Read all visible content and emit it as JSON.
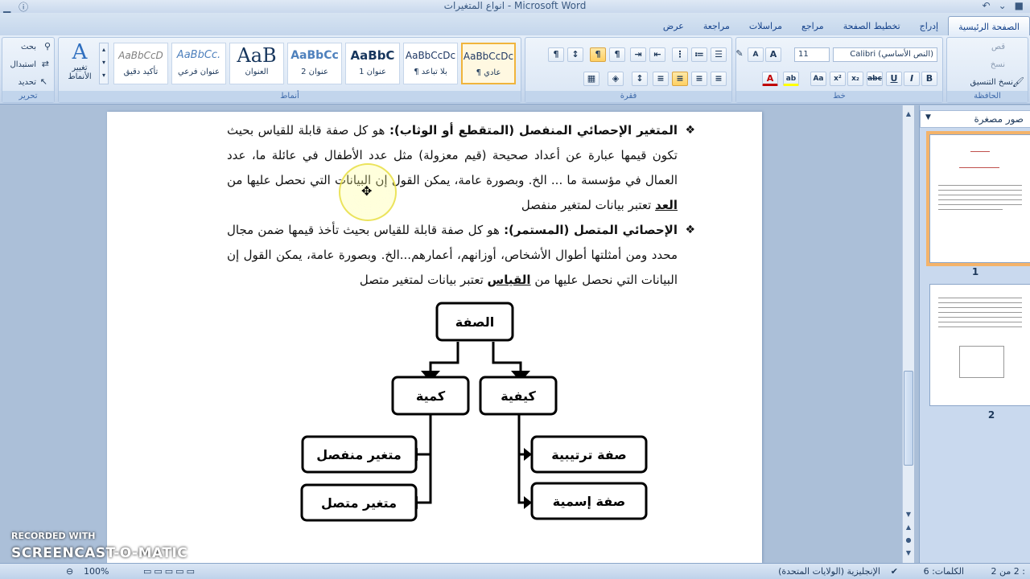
{
  "window": {
    "title": "انواع المتغيرات - Microsoft Word"
  },
  "tabs": [
    "الصفحة الرئيسية",
    "إدراج",
    "تخطيط الصفحة",
    "مراجع",
    "مراسلات",
    "مراجعة",
    "عرض"
  ],
  "ribbon": {
    "clipboard": {
      "label": "الحافظة",
      "cut": "قص",
      "copy": "نسخ",
      "format_painter": "نسخ التنسيق"
    },
    "font": {
      "label": "خط",
      "name": "(النص الأساسي) Calibri",
      "size": "11"
    },
    "paragraph": {
      "label": "فقرة"
    },
    "styles": {
      "label": "أنماط",
      "change_styles": "تغيير الأنماط",
      "items": [
        {
          "preview": "AaBbCcDc",
          "name": "¶ عادي"
        },
        {
          "preview": "AaBbCcDc",
          "name": "¶ بلا تباعد"
        },
        {
          "preview": "AaBbC",
          "name": "عنوان 1"
        },
        {
          "preview": "AaBbCc",
          "name": "عنوان 2"
        },
        {
          "preview": "AaB",
          "name": "العنوان"
        },
        {
          "preview": "AaBbCc.",
          "name": "عنوان فرعي"
        },
        {
          "preview": "AaBbCcD",
          "name": "تأكيد دقيق"
        }
      ]
    },
    "editing": {
      "label": "تحرير",
      "find": "بحث",
      "replace": "استبدال",
      "select": "تحديد"
    }
  },
  "document": {
    "para1": {
      "bold": "المتغير الإحصائي المنفصل (المتقطع أو الوثاب):",
      "text": " هو كل صفة قابلة للقياس بحيث تكون قيمها عبارة عن أعداد صحيحة (قيم معزولة) مثل عدد الأطفال في عائلة ما، عدد العمال في مؤسسة ما ... الخ. وبصورة عامة، يمكن القول إن البيانات التي نحصل عليها من ",
      "underline": "العد",
      "tail": " تعتبر بيانات لمتغير منفصل"
    },
    "para2": {
      "bold": "الإحصائي المتصل (المستمر):",
      "text": " هو كل صفة قابلة للقياس بحيث تأخذ قيمها ضمن مجال محدد ومن أمثلتها أطوال الأشخاص، أوزانهم، أعمارهم...الخ. وبصورة عامة، يمكن القول إن البيانات التي نحصل عليها من ",
      "underline": "القياس",
      "tail": " تعتبر بيانات لمتغير متصل"
    },
    "diagram": {
      "root": "الصفة",
      "qualitative": "كيفية",
      "quantitative": "كمية",
      "ordinal": "صفة ترتيبية",
      "nominal": "صفة إسمية",
      "discrete": "متغير منفصل",
      "continuous": "متغير متصل"
    }
  },
  "thumbnails": {
    "header": "صور مصغرة",
    "pages": [
      "1",
      "2"
    ]
  },
  "status": {
    "page": "2 من 2",
    "words": "الكلمات: 6",
    "language": "الإنجليزية (الولايات المتحدة)",
    "zoom": "100%"
  },
  "watermark": {
    "line1": "RECORDED WITH",
    "line2": "SCREENCAST-O-MATIC"
  }
}
